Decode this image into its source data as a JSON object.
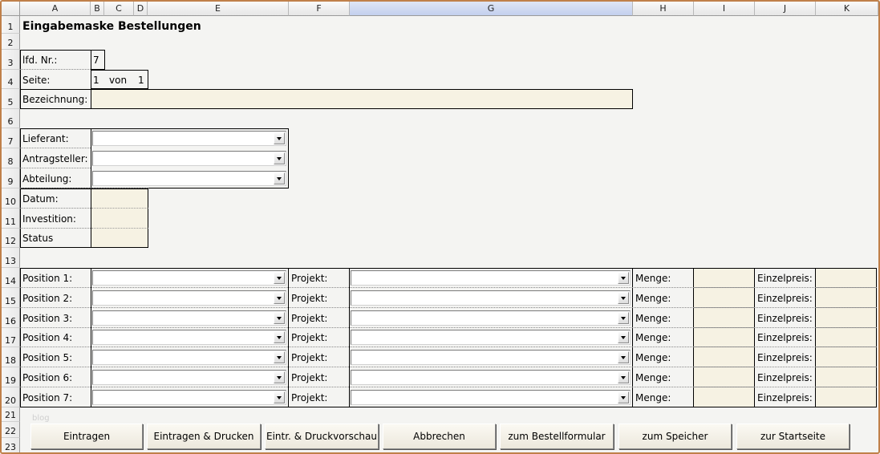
{
  "columns": [
    "A",
    "B",
    "C",
    "D",
    "E",
    "F",
    "G",
    "H",
    "I",
    "J",
    "K"
  ],
  "rows": [
    "1",
    "2",
    "3",
    "4",
    "5",
    "6",
    "7",
    "8",
    "9",
    "10",
    "11",
    "12",
    "13",
    "14",
    "15",
    "16",
    "17",
    "18",
    "19",
    "20",
    "21",
    "22",
    "23"
  ],
  "title": "Eingabemaske Bestellungen",
  "header_fields": {
    "lfd_label": "lfd. Nr.:",
    "lfd_value": "7",
    "seite_label": "Seite:",
    "seite_current": "1",
    "seite_von": "von",
    "seite_total": "1",
    "bezeichnung_label": "Bezeichnung:"
  },
  "detail_fields": {
    "lieferant": "Lieferant:",
    "antragsteller": "Antragsteller:",
    "abteilung": "Abteilung:",
    "datum": "Datum:",
    "investition": "Investition:",
    "status": "Status"
  },
  "positions": [
    {
      "label": "Position 1:",
      "projekt": "Projekt:",
      "menge": "Menge:",
      "einzelpreis": "Einzelpreis:"
    },
    {
      "label": "Position 2:",
      "projekt": "Projekt:",
      "menge": "Menge:",
      "einzelpreis": "Einzelpreis:"
    },
    {
      "label": "Position 3:",
      "projekt": "Projekt:",
      "menge": "Menge:",
      "einzelpreis": "Einzelpreis:"
    },
    {
      "label": "Position 4:",
      "projekt": "Projekt:",
      "menge": "Menge:",
      "einzelpreis": "Einzelpreis:"
    },
    {
      "label": "Position 5:",
      "projekt": "Projekt:",
      "menge": "Menge:",
      "einzelpreis": "Einzelpreis:"
    },
    {
      "label": "Position 6:",
      "projekt": "Projekt:",
      "menge": "Menge:",
      "einzelpreis": "Einzelpreis:"
    },
    {
      "label": "Position 7:",
      "projekt": "Projekt:",
      "menge": "Menge:",
      "einzelpreis": "Einzelpreis:"
    }
  ],
  "watermark": "blog",
  "buttons": [
    "Eintragen",
    "Eintragen & Drucken",
    "Eintr. & Druckvorschau",
    "Abbrechen",
    "zum Bestellformular",
    "zum Speicher",
    "zur Startseite"
  ],
  "colors": {
    "input_fill": "#f6f2e3",
    "frame": "#c0804a",
    "selected_header": "#c3cfee"
  }
}
